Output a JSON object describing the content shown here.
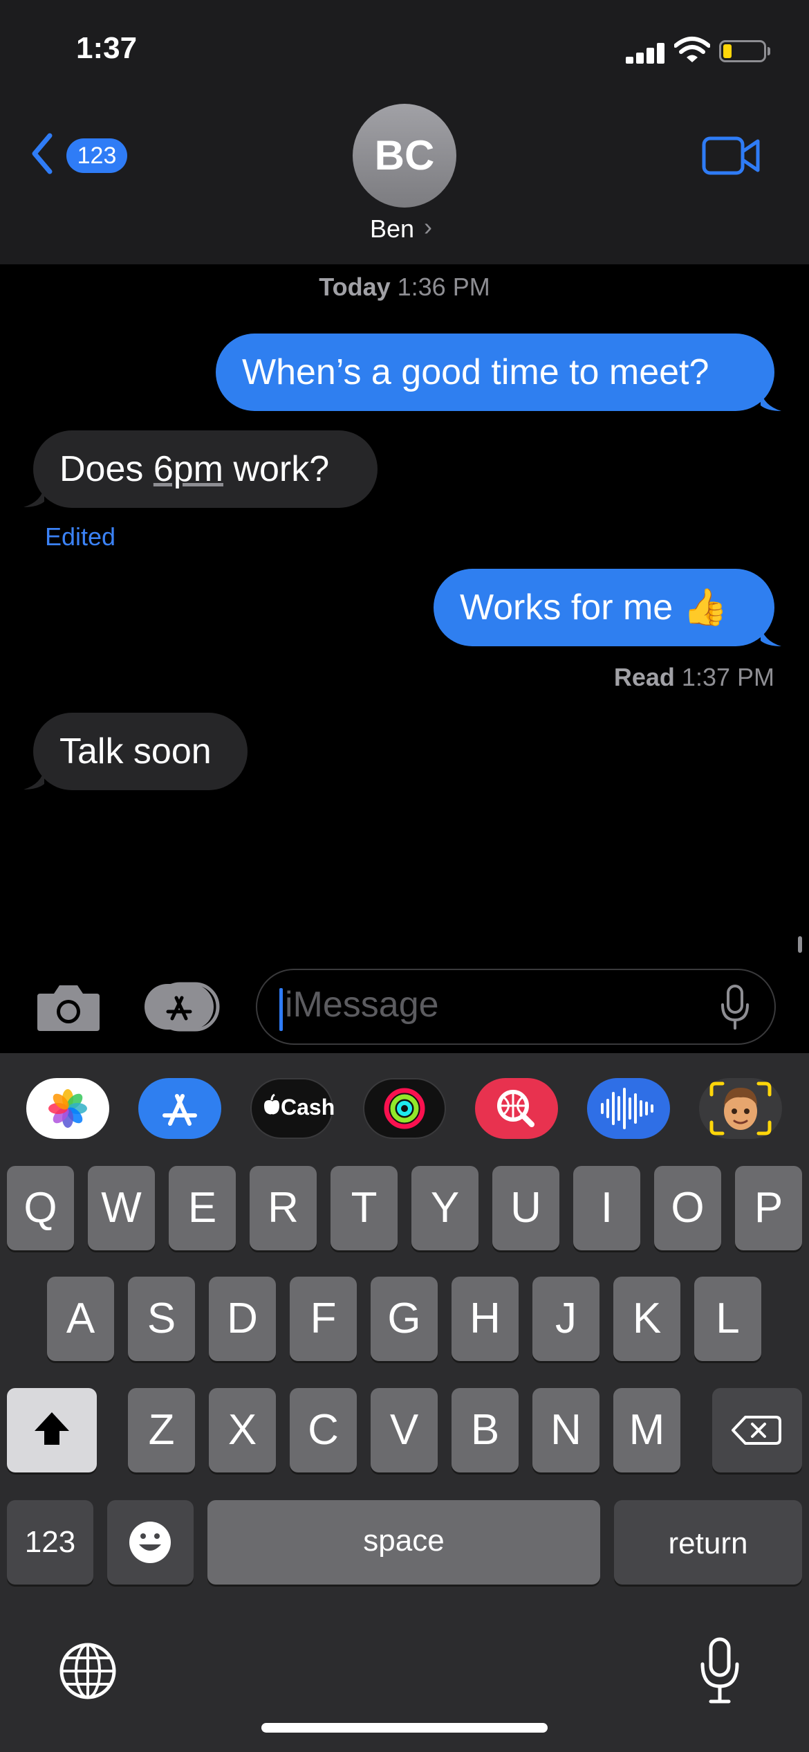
{
  "status_bar": {
    "time": "1:37"
  },
  "header": {
    "back_count": "123",
    "avatar_initials": "BC",
    "contact_name": "Ben",
    "contact_chevron": "›",
    "video_icon": "video-camera-icon"
  },
  "conversation": {
    "timestamp_day": "Today",
    "timestamp_time": " 1:36 PM",
    "messages": [
      {
        "direction": "outgoing",
        "text": "When’s a good time to meet?"
      },
      {
        "direction": "incoming",
        "prefix": "Does ",
        "link": "6pm",
        "suffix": " work?"
      },
      {
        "direction": "outgoing",
        "text": "Works for me 👍"
      },
      {
        "direction": "incoming",
        "text": "Talk soon"
      }
    ],
    "edited_label": "Edited",
    "read_label": "Read",
    "read_time": " 1:37 PM"
  },
  "input": {
    "placeholder": "iMessage",
    "camera_icon": "camera-icon",
    "apps_icon": "app-store-icon",
    "mic_icon": "microphone-icon"
  },
  "app_drawer": {
    "apps": [
      {
        "name": "Photos",
        "icon": "photos-icon"
      },
      {
        "name": "App Store",
        "icon": "app-store-icon"
      },
      {
        "name": "Cash",
        "label": "Cash",
        "icon": "apple-cash-icon"
      },
      {
        "name": "Activity",
        "icon": "activity-rings-icon"
      },
      {
        "name": "Images",
        "icon": "image-search-icon"
      },
      {
        "name": "Audio",
        "icon": "audio-waveform-icon"
      },
      {
        "name": "Memoji",
        "icon": "memoji-icon"
      }
    ]
  },
  "keyboard": {
    "row1": [
      "Q",
      "W",
      "E",
      "R",
      "T",
      "Y",
      "U",
      "I",
      "O",
      "P"
    ],
    "row2": [
      "A",
      "S",
      "D",
      "F",
      "G",
      "H",
      "J",
      "K",
      "L"
    ],
    "row3": [
      "Z",
      "X",
      "C",
      "V",
      "B",
      "N",
      "M"
    ],
    "numbers_label": "123",
    "space_label": "space",
    "return_label": "return"
  },
  "colors": {
    "accent_blue": "#2f7ff0",
    "incoming_bubble": "#262628",
    "key": "#6b6b6e",
    "function_key": "#464649"
  }
}
